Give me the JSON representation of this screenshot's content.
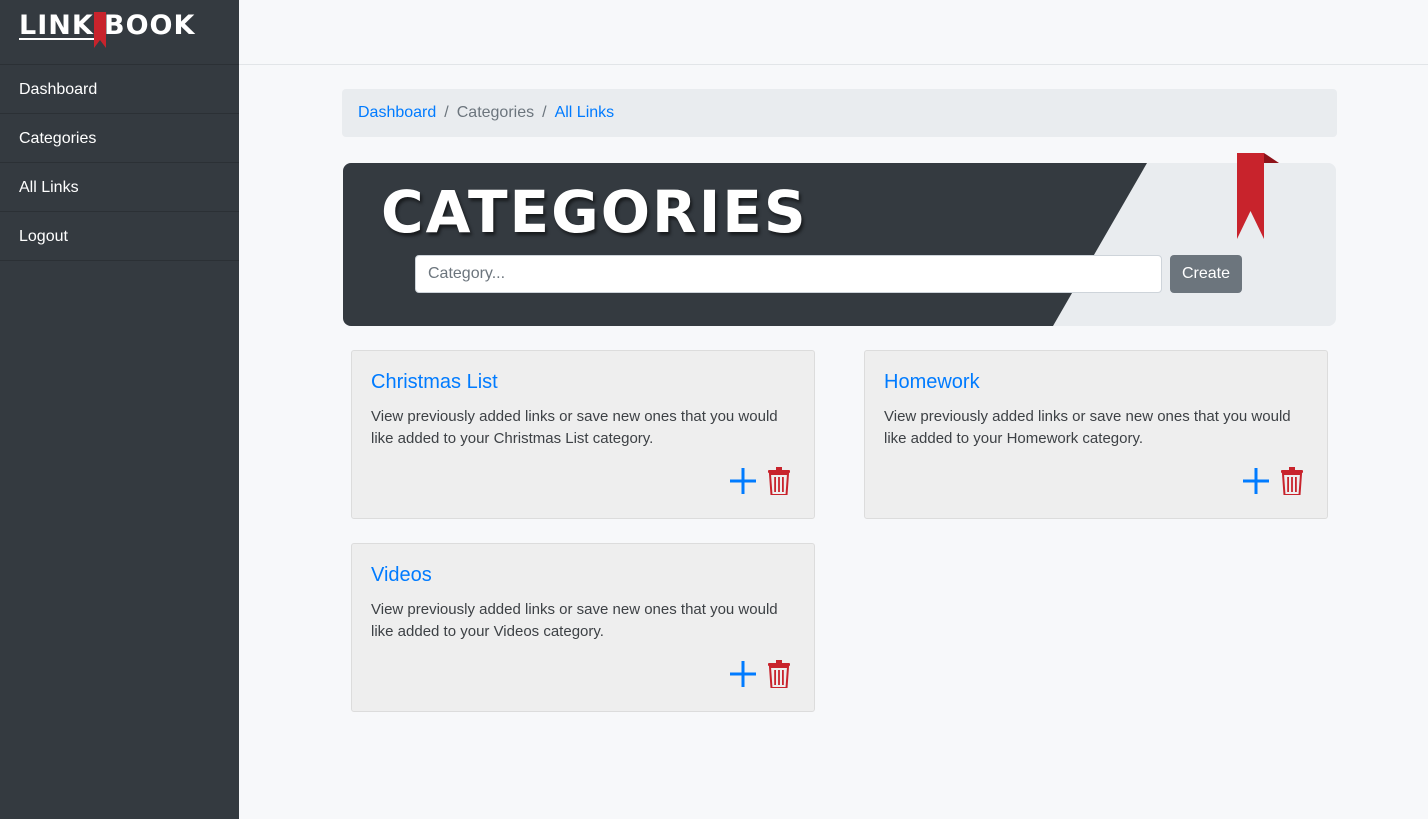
{
  "app": {
    "logo_left": "LINK",
    "logo_right": "BOOK"
  },
  "sidebar": {
    "items": [
      {
        "label": "Dashboard"
      },
      {
        "label": "Categories"
      },
      {
        "label": "All Links"
      },
      {
        "label": "Logout"
      }
    ]
  },
  "breadcrumb": {
    "items": [
      {
        "label": "Dashboard",
        "link": true
      },
      {
        "label": "Categories",
        "link": false
      },
      {
        "label": "All Links",
        "link": true
      }
    ],
    "separator": "/"
  },
  "hero": {
    "title": "CATEGORIES",
    "input_placeholder": "Category...",
    "input_value": "",
    "button_label": "Create"
  },
  "cards": [
    {
      "title": "Christmas List",
      "text": "View previously added links or save new ones that you would like added to your Christmas List category.",
      "add_icon": "plus-icon",
      "delete_icon": "trash-icon"
    },
    {
      "title": "Homework",
      "text": "View previously added links or save new ones that you would like added to your Homework category.",
      "add_icon": "plus-icon",
      "delete_icon": "trash-icon"
    },
    {
      "title": "Videos",
      "text": "View previously added links or save new ones that you would like added to your Videos category.",
      "add_icon": "plus-icon",
      "delete_icon": "trash-icon"
    }
  ],
  "colors": {
    "sidebar_bg": "#343a40",
    "link": "#007bff",
    "danger": "#c8232c",
    "button_secondary": "#6c757d",
    "page_bg": "#f7f8fa"
  }
}
